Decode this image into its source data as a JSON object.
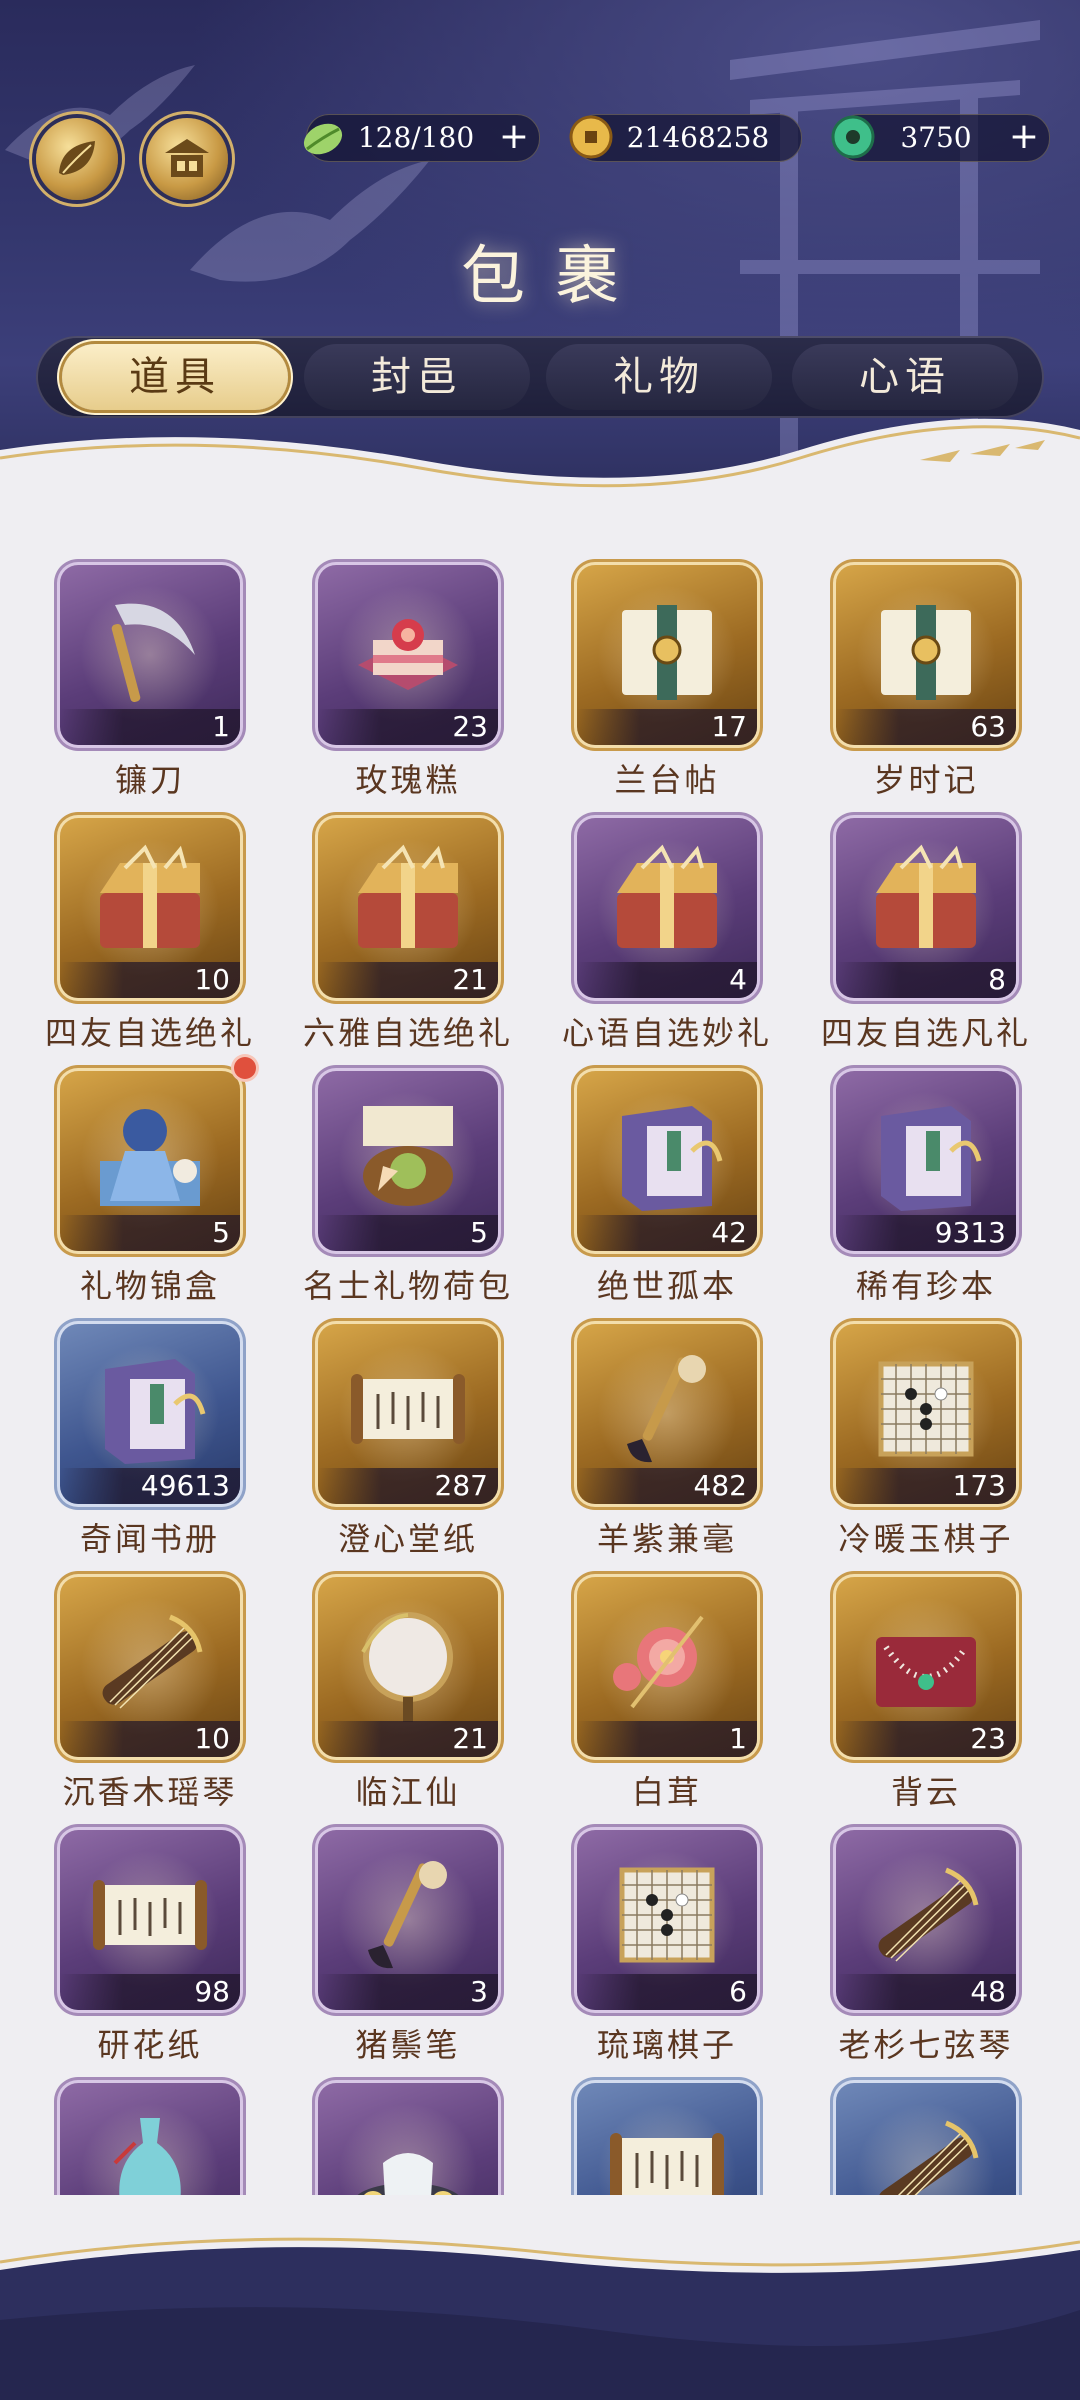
{
  "header": {
    "title": "包裹",
    "stamina": "128/180",
    "coins": "21468258",
    "jade": "3750"
  },
  "tabs": [
    {
      "label": "道具",
      "active": true
    },
    {
      "label": "封邑",
      "active": false
    },
    {
      "label": "礼物",
      "active": false
    },
    {
      "label": "心语",
      "active": false
    }
  ],
  "items": [
    {
      "name": "镰刀",
      "count": "1",
      "rarity": "purple",
      "icon": "sickle-icon"
    },
    {
      "name": "玫瑰糕",
      "count": "23",
      "rarity": "purple",
      "icon": "rose-cake-icon"
    },
    {
      "name": "兰台帖",
      "count": "17",
      "rarity": "gold",
      "icon": "letter-icon"
    },
    {
      "name": "岁时记",
      "count": "63",
      "rarity": "gold",
      "icon": "letter-icon"
    },
    {
      "name": "四友自选绝礼",
      "count": "10",
      "rarity": "gold",
      "icon": "gift-box-icon"
    },
    {
      "name": "六雅自选绝礼",
      "count": "21",
      "rarity": "gold",
      "icon": "gift-box-icon"
    },
    {
      "name": "心语自选妙礼",
      "count": "4",
      "rarity": "purple",
      "icon": "gift-box-icon"
    },
    {
      "name": "四友自选凡礼",
      "count": "8",
      "rarity": "purple",
      "icon": "gift-box-icon"
    },
    {
      "name": "礼物锦盒",
      "count": "5",
      "rarity": "gold",
      "icon": "gift-set-icon",
      "badge": true
    },
    {
      "name": "名士礼物荷包",
      "count": "5",
      "rarity": "purple",
      "icon": "pouch-icon"
    },
    {
      "name": "绝世孤本",
      "count": "42",
      "rarity": "gold",
      "icon": "book-icon"
    },
    {
      "name": "稀有珍本",
      "count": "9313",
      "rarity": "purple",
      "icon": "book-icon"
    },
    {
      "name": "奇闻书册",
      "count": "49613",
      "rarity": "blue",
      "icon": "book-icon"
    },
    {
      "name": "澄心堂纸",
      "count": "287",
      "rarity": "gold",
      "icon": "scroll-icon"
    },
    {
      "name": "羊紫兼毫",
      "count": "482",
      "rarity": "gold",
      "icon": "brush-icon"
    },
    {
      "name": "冷暖玉棋子",
      "count": "173",
      "rarity": "gold",
      "icon": "go-board-icon"
    },
    {
      "name": "沉香木瑶琴",
      "count": "10",
      "rarity": "gold",
      "icon": "zither-icon"
    },
    {
      "name": "临江仙",
      "count": "21",
      "rarity": "gold",
      "icon": "fan-icon"
    },
    {
      "name": "白茸",
      "count": "1",
      "rarity": "gold",
      "icon": "flower-icon"
    },
    {
      "name": "背云",
      "count": "23",
      "rarity": "gold",
      "icon": "necklace-icon"
    },
    {
      "name": "研花纸",
      "count": "98",
      "rarity": "purple",
      "icon": "scroll-icon"
    },
    {
      "name": "猪鬃笔",
      "count": "3",
      "rarity": "purple",
      "icon": "brush-icon"
    },
    {
      "name": "琉璃棋子",
      "count": "6",
      "rarity": "purple",
      "icon": "go-board-icon"
    },
    {
      "name": "老杉七弦琴",
      "count": "48",
      "rarity": "purple",
      "icon": "zither-icon"
    },
    {
      "name": "",
      "count": "",
      "rarity": "purple",
      "icon": "vase-icon"
    },
    {
      "name": "",
      "count": "",
      "rarity": "purple",
      "icon": "tea-set-icon"
    },
    {
      "name": "",
      "count": "",
      "rarity": "blue",
      "icon": "scroll-icon"
    },
    {
      "name": "",
      "count": "",
      "rarity": "blue",
      "icon": "zither-icon"
    }
  ],
  "colors": {
    "header_bg": "#2a2b5c",
    "page_bg": "#efeef2",
    "item_name": "#5a3620",
    "tab_active": "#e7cd8c"
  }
}
